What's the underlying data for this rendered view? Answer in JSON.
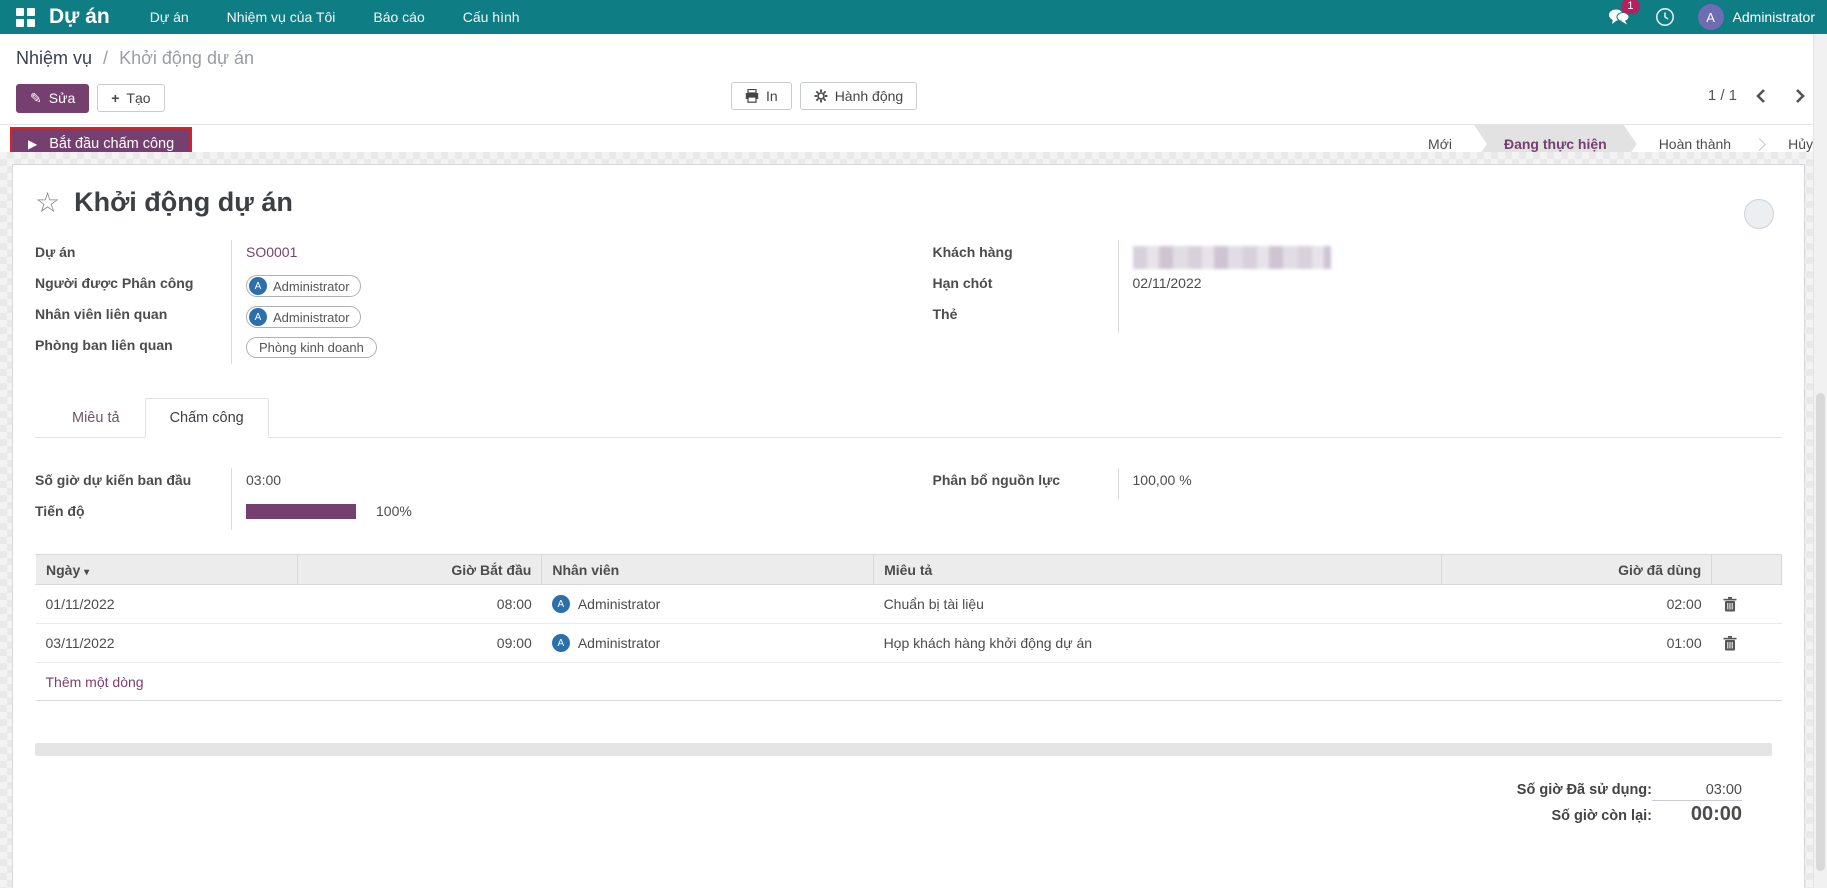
{
  "nav": {
    "brand": "Dự án",
    "items": [
      "Dự án",
      "Nhiệm vụ của Tôi",
      "Báo cáo",
      "Cấu hình"
    ],
    "messages_badge": "1",
    "user_name": "Administrator",
    "user_avatar_letter": "A"
  },
  "breadcrumb": {
    "parent": "Nhiệm vụ",
    "separator": "/",
    "current": "Khởi động dự án"
  },
  "control": {
    "edit_label": "Sửa",
    "create_label": "Tạo",
    "print_label": "In",
    "action_label": "Hành động",
    "pager": "1 / 1"
  },
  "statusbar": {
    "start_button_label": "Bắt đầu chấm công",
    "stages": [
      {
        "label": "Mới",
        "active": false
      },
      {
        "label": "Đang thực hiện",
        "active": true
      },
      {
        "label": "Hoàn thành",
        "active": false
      },
      {
        "label": "Hủy",
        "active": false
      }
    ]
  },
  "form": {
    "title": "Khởi động dự án",
    "left_fields": {
      "project": {
        "label": "Dự án",
        "value": "SO0001"
      },
      "assignee": {
        "label": "Người được Phân công",
        "value": "Administrator",
        "avatar_letter": "A"
      },
      "employee": {
        "label": "Nhân viên liên quan",
        "value": "Administrator",
        "avatar_letter": "A"
      },
      "department": {
        "label": "Phòng ban liên quan",
        "value": "Phòng kinh doanh"
      }
    },
    "right_fields": {
      "customer": {
        "label": "Khách hàng",
        "value": "",
        "redacted": true
      },
      "deadline": {
        "label": "Hạn chót",
        "value": "02/11/2022"
      },
      "tags": {
        "label": "Thẻ",
        "value": ""
      }
    }
  },
  "tabs": [
    {
      "label": "Miêu tả",
      "active": false
    },
    {
      "label": "Chấm công",
      "active": true
    }
  ],
  "timesheet": {
    "planned_hours_label": "Số giờ dự kiến ban đầu",
    "planned_hours": "03:00",
    "progress_label": "Tiến độ",
    "progress_text": "100%",
    "progress_percent": 100,
    "allocation_label": "Phân bổ nguồn lực",
    "allocation_value": "100,00 %",
    "table": {
      "headers": [
        "Ngày",
        "Giờ Bắt đầu",
        "Nhân viên",
        "Miêu tả",
        "Giờ đã dùng"
      ],
      "rows": [
        {
          "date": "01/11/2022",
          "start": "08:00",
          "employee": "Administrator",
          "avatar_letter": "A",
          "description": "Chuẩn bị tài liệu",
          "hours": "02:00"
        },
        {
          "date": "03/11/2022",
          "start": "09:00",
          "employee": "Administrator",
          "avatar_letter": "A",
          "description": "Họp khách hàng khởi động dự án",
          "hours": "01:00"
        }
      ],
      "add_row_label": "Thêm một dòng"
    },
    "summary": {
      "used_label": "Số giờ Đã sử dụng:",
      "used_value": "03:00",
      "remaining_label": "Số giờ còn lại:",
      "remaining_value": "00:00"
    }
  },
  "colors": {
    "navbar": "#0e7d84",
    "accent_purple": "#75406f",
    "link_purple": "#7c3f6f",
    "avatar_blue": "#2c6fad",
    "nav_avatar_purple": "#6f6cb3",
    "badge_magenta": "#b5205f",
    "annotation_red": "#e02020"
  }
}
